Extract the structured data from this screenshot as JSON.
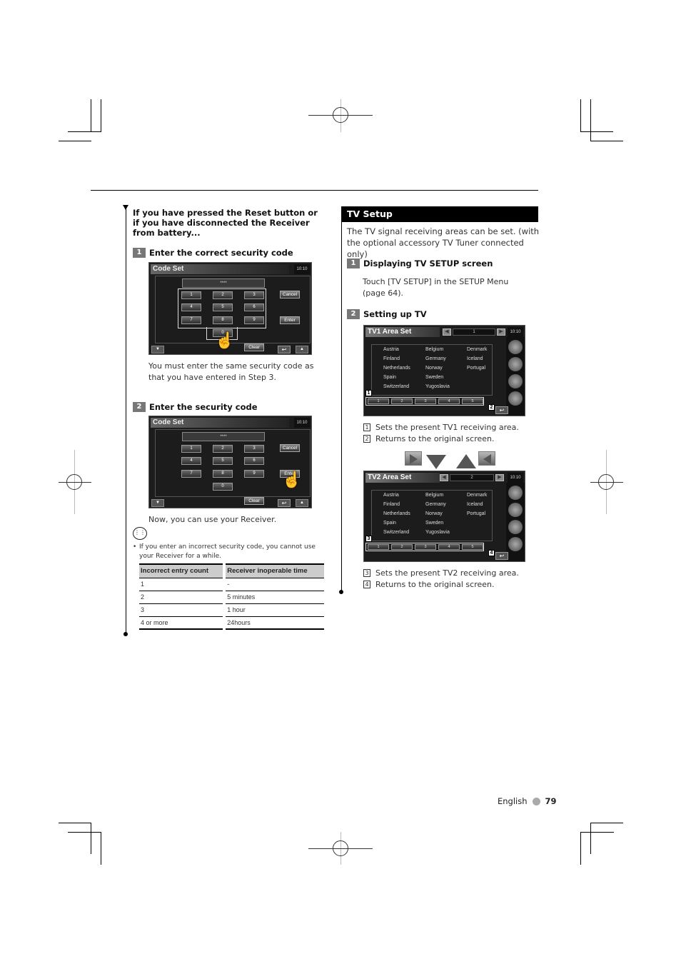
{
  "left": {
    "intro": "If you have pressed the Reset button or if you have disconnected the Receiver from battery...",
    "step1": {
      "num": "1",
      "title": "Enter the correct security code"
    },
    "screen1": {
      "title": "Code Set",
      "clock": "10:10",
      "code": "****",
      "keys": [
        "1",
        "2",
        "3",
        "4",
        "5",
        "6",
        "7",
        "8",
        "9",
        "0"
      ],
      "cancel": "Cancel",
      "enter": "Enter",
      "clear": "Clear",
      "vol_down": "▼",
      "vol_up": "▲",
      "return": "↩"
    },
    "step1_text": "You must enter the same security code as that you have entered in Step 3.",
    "step2": {
      "num": "2",
      "title": "Enter the security code"
    },
    "screen2": {
      "title": "Code Set",
      "clock": "10:10",
      "code": "****",
      "cancel": "Cancel",
      "enter": "Enter",
      "clear": "Clear"
    },
    "step2_text": "Now, you can use your Receiver.",
    "note_bullet": "If you enter an incorrect security code, you cannot use your Receiver for a while.",
    "table": {
      "headers": [
        "Incorrect entry count",
        "Receiver inoperable time"
      ],
      "rows": [
        [
          "1",
          "-"
        ],
        [
          "2",
          "5 minutes"
        ],
        [
          "3",
          "1 hour"
        ],
        [
          "4 or more",
          "24hours"
        ]
      ]
    }
  },
  "right": {
    "section_title": "TV Setup",
    "intro": "The TV signal receiving areas can be set. (with the optional accessory TV Tuner connected only)",
    "step1": {
      "num": "1",
      "title": "Displaying TV SETUP screen"
    },
    "step1_text": "Touch [TV SETUP] in the SETUP Menu (page 64).",
    "step2": {
      "num": "2",
      "title": "Setting up TV"
    },
    "tv1": {
      "title": "TV1 Area Set",
      "selected": "1",
      "clock": "10:10",
      "countries": [
        "Austria",
        "Belgium",
        "Denmark",
        "Finland",
        "Germany",
        "Iceland",
        "Netherlands",
        "Norway",
        "Portugal",
        "Spain",
        "Sweden",
        "",
        "Switzerland",
        "Yugoslavia",
        ""
      ],
      "tabs": [
        "1",
        "2",
        "3",
        "4",
        "5"
      ],
      "callouts": [
        "1",
        "2"
      ]
    },
    "legend1": [
      {
        "num": "1",
        "text": "Sets the present TV1 receiving area."
      },
      {
        "num": "2",
        "text": "Returns to the original screen."
      }
    ],
    "tv2": {
      "title": "TV2 Area Set",
      "selected": "2",
      "clock": "10:10",
      "countries": [
        "Austria",
        "Belgium",
        "Denmark",
        "Finland",
        "Germany",
        "Iceland",
        "Netherlands",
        "Norway",
        "Portugal",
        "Spain",
        "Sweden",
        "",
        "Switzerland",
        "Yugoslavia",
        ""
      ],
      "tabs": [
        "1",
        "2",
        "3",
        "4",
        "5"
      ],
      "callouts": [
        "3",
        "4"
      ]
    },
    "legend2": [
      {
        "num": "3",
        "text": "Sets the present TV2 receiving area."
      },
      {
        "num": "4",
        "text": "Returns to the original screen."
      }
    ]
  },
  "footer": {
    "language": "English",
    "page": "79"
  }
}
